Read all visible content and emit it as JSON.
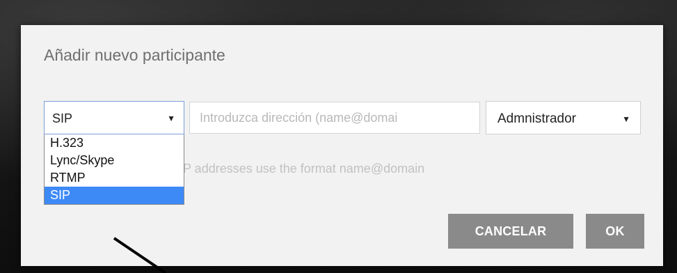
{
  "dialog": {
    "title": "Añadir nuevo participante",
    "protocol_select": {
      "selected": "SIP",
      "options": [
        "H.323",
        "Lync/Skype",
        "RTMP",
        "SIP"
      ],
      "highlighted_index": 3
    },
    "address_input": {
      "value": "",
      "placeholder": "Introduzca dirección (name@domai"
    },
    "role_select": {
      "selected": "Admnistrador"
    },
    "hint": "P addresses use the format name@domain",
    "buttons": {
      "cancel_label": "CANCELAR",
      "ok_label": "OK"
    }
  },
  "colors": {
    "dialog_bg": "#f2f2f2",
    "button_bg": "#8a8a8a",
    "highlight": "#3d8af7"
  },
  "icons": {
    "dropdown_caret": "caret-down-icon",
    "annotation": "arrow-pointer"
  }
}
